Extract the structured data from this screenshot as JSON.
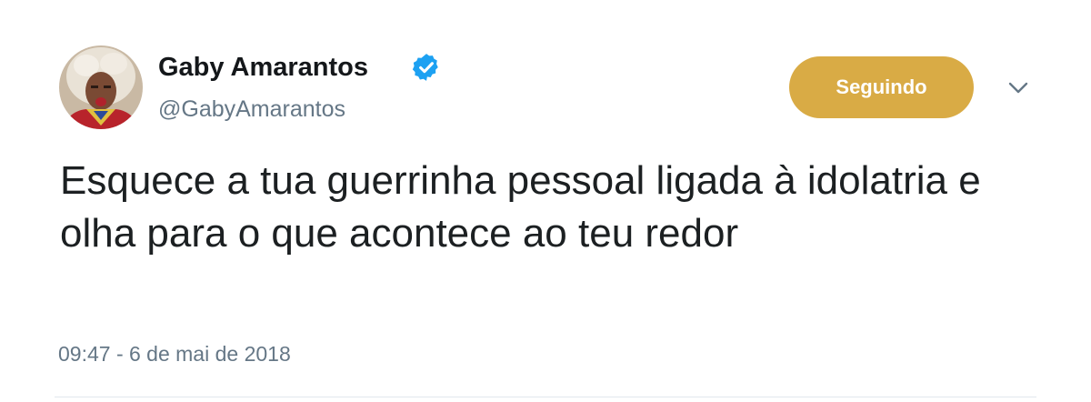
{
  "user": {
    "display_name": "Gaby Amarantos",
    "handle": "@GabyAmarantos",
    "verified_icon": "verified-badge-icon"
  },
  "actions": {
    "follow_label": "Seguindo",
    "menu_icon": "chevron-down-icon"
  },
  "tweet": {
    "text": "Esquece a tua guerrinha pessoal ligada à idolatria e olha para o que acontece ao teu redor",
    "timestamp": "09:47 - 6 de mai de 2018"
  },
  "colors": {
    "follow_button": "#d9ab45",
    "verified": "#1da1f2",
    "secondary_text": "#657786"
  }
}
